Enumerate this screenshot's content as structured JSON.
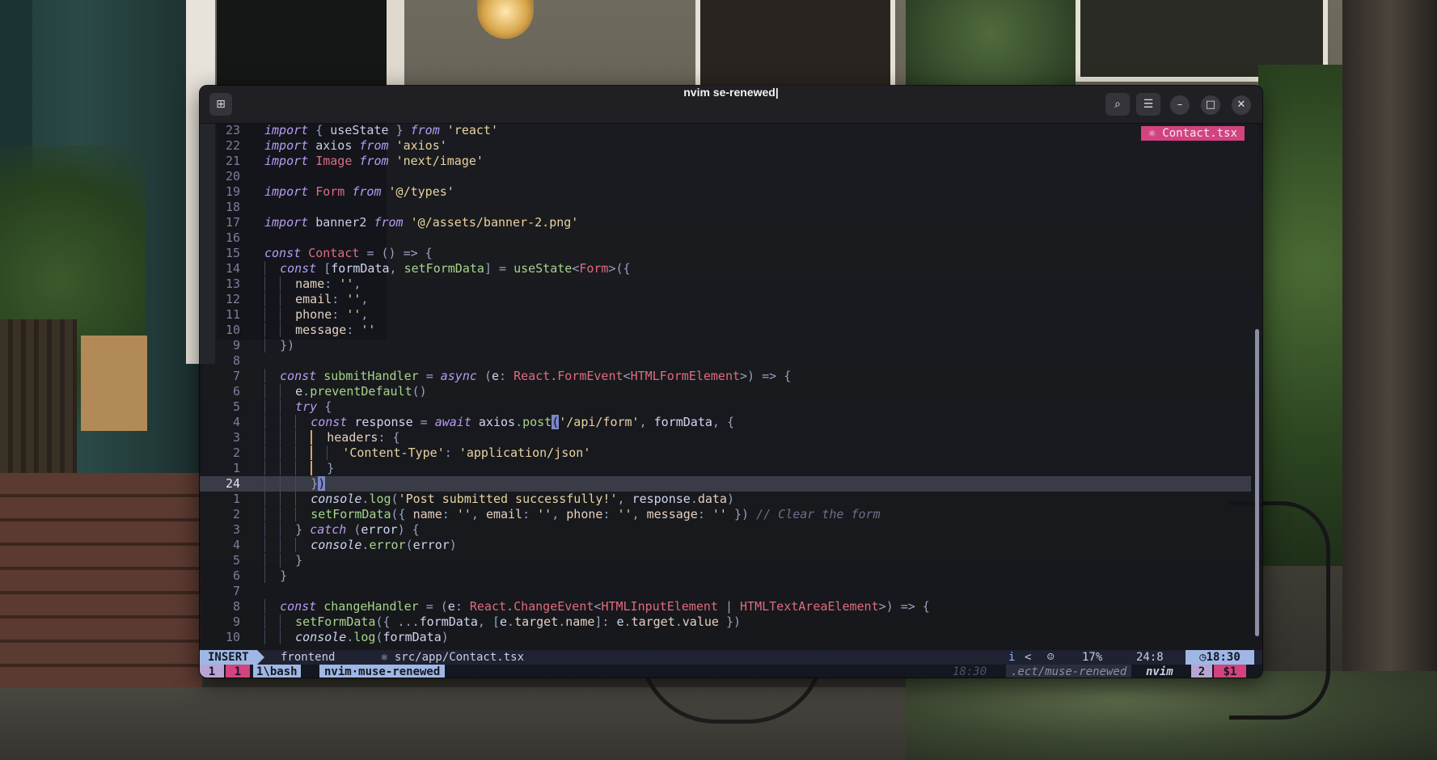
{
  "window": {
    "title": "nvim se-renewed|",
    "new_tab_icon": "new-tab-icon",
    "search_icon": "search-icon",
    "menu_icon": "hamburger-menu-icon",
    "minimize_label": "–",
    "maximize_label": "□",
    "close_label": "✕"
  },
  "editor": {
    "file_tag": "⚛ Contact.tsx",
    "current_line": "24",
    "lines": [
      {
        "n": "23"
      },
      {
        "n": "22"
      },
      {
        "n": "21"
      },
      {
        "n": "20"
      },
      {
        "n": "19"
      },
      {
        "n": "18"
      },
      {
        "n": "17"
      },
      {
        "n": "16"
      },
      {
        "n": "15"
      },
      {
        "n": "14"
      },
      {
        "n": "13"
      },
      {
        "n": "12"
      },
      {
        "n": "11"
      },
      {
        "n": "10"
      },
      {
        "n": "9"
      },
      {
        "n": "8"
      },
      {
        "n": "7"
      },
      {
        "n": "6"
      },
      {
        "n": "5"
      },
      {
        "n": "4"
      },
      {
        "n": "3"
      },
      {
        "n": "2"
      },
      {
        "n": "1"
      },
      {
        "n": "24"
      },
      {
        "n": "1"
      },
      {
        "n": "2"
      },
      {
        "n": "3"
      },
      {
        "n": "4"
      },
      {
        "n": "5"
      },
      {
        "n": "6"
      },
      {
        "n": "7"
      },
      {
        "n": "8"
      },
      {
        "n": "9"
      },
      {
        "n": "10"
      }
    ]
  },
  "statusline": {
    "mode": "INSERT",
    "branch": " frontend",
    "file": "⚛ src/app/Contact.tsx",
    "indicator_i": "i",
    "indicator_lt": "<",
    "bot_icon": "copilot-icon",
    "percent": "17%",
    "position": "24:8",
    "time": "◷18:30"
  },
  "tmux": {
    "session": "1",
    "alert": "1",
    "window1": "1\\bash",
    "window2": "nvim·muse-renewed",
    "clock": "18:30",
    "path": ".ect/muse-renewed",
    "host": "nvim",
    "pane_count": "2",
    "last_status": "$1"
  },
  "colors": {
    "mode_bg": "#9fb7e4",
    "accent_pink": "#d2437f",
    "accent_purple": "#b8a5d3"
  }
}
